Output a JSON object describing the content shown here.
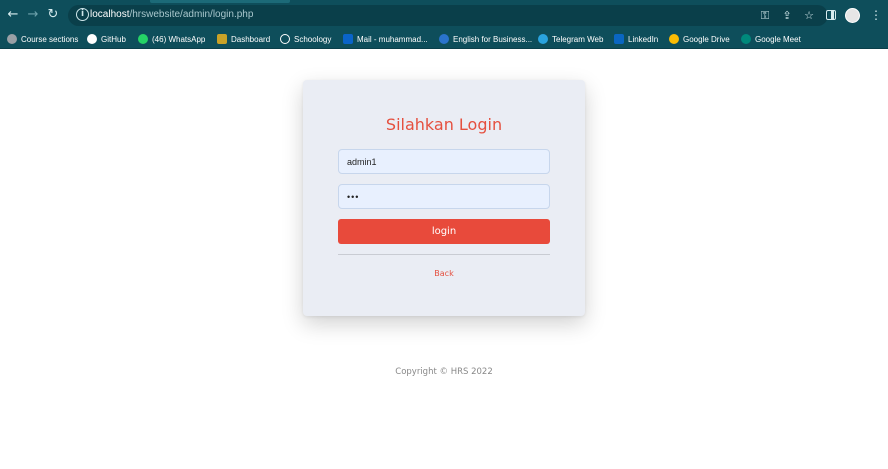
{
  "browser": {
    "url_host": "localhost",
    "url_path": "/hrswebsite/admin/login.php",
    "bookmarks": [
      {
        "label": "Course sections",
        "icon": "course-icon",
        "color": "#9aa0a6"
      },
      {
        "label": "GitHub",
        "icon": "github-icon",
        "color": "#ffffff"
      },
      {
        "label": "(46) WhatsApp",
        "icon": "whatsapp-icon",
        "color": "#25d366"
      },
      {
        "label": "Dashboard",
        "icon": "dashboard-icon",
        "color": "#c9a227"
      },
      {
        "label": "Schoology",
        "icon": "schoology-icon",
        "color": "#ffffff"
      },
      {
        "label": "Mail - muhammad...",
        "icon": "outlook-icon",
        "color": "#0a64c9"
      },
      {
        "label": "English for Business...",
        "icon": "coursera-icon",
        "color": "#2a73cc"
      },
      {
        "label": "Telegram Web",
        "icon": "telegram-icon",
        "color": "#2aa3df"
      },
      {
        "label": "LinkedIn",
        "icon": "linkedin-icon",
        "color": "#0a66c2"
      },
      {
        "label": "Google Drive",
        "icon": "google-drive-icon",
        "color": "#fbbc04"
      },
      {
        "label": "Google Meet",
        "icon": "google-meet-icon",
        "color": "#00897b"
      }
    ]
  },
  "login": {
    "title": "Silahkan Login",
    "username_value": "admin1",
    "password_value": "•••",
    "button_label": "login",
    "back_label": "Back"
  },
  "footer": {
    "copyright": "Copyright © HRS 2022"
  },
  "colors": {
    "accent": "#e84a3b",
    "chrome": "#0e4e5b",
    "card": "#eaedf4"
  }
}
